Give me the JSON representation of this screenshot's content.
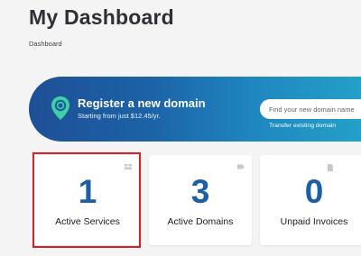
{
  "header": {
    "title": "My Dashboard",
    "breadcrumb": "Dashboard"
  },
  "banner": {
    "icon": "location-pin-icon",
    "title": "Register a new domain",
    "subtitle": "Starting from just $12.45/yr.",
    "search_placeholder": "Find your new domain name",
    "transfer_label": "Transfer existing domain"
  },
  "stats": [
    {
      "count": "1",
      "label": "Active Services",
      "icon": "services-icon"
    },
    {
      "count": "3",
      "label": "Active Domains",
      "icon": "domains-icon"
    },
    {
      "count": "0",
      "label": "Unpaid Invoices",
      "icon": "invoice-icon"
    }
  ],
  "colors": {
    "accent": "#1d5fa5",
    "banner_start": "#1e4f96",
    "banner_end": "#23a3c9",
    "highlight": "#d92027"
  }
}
